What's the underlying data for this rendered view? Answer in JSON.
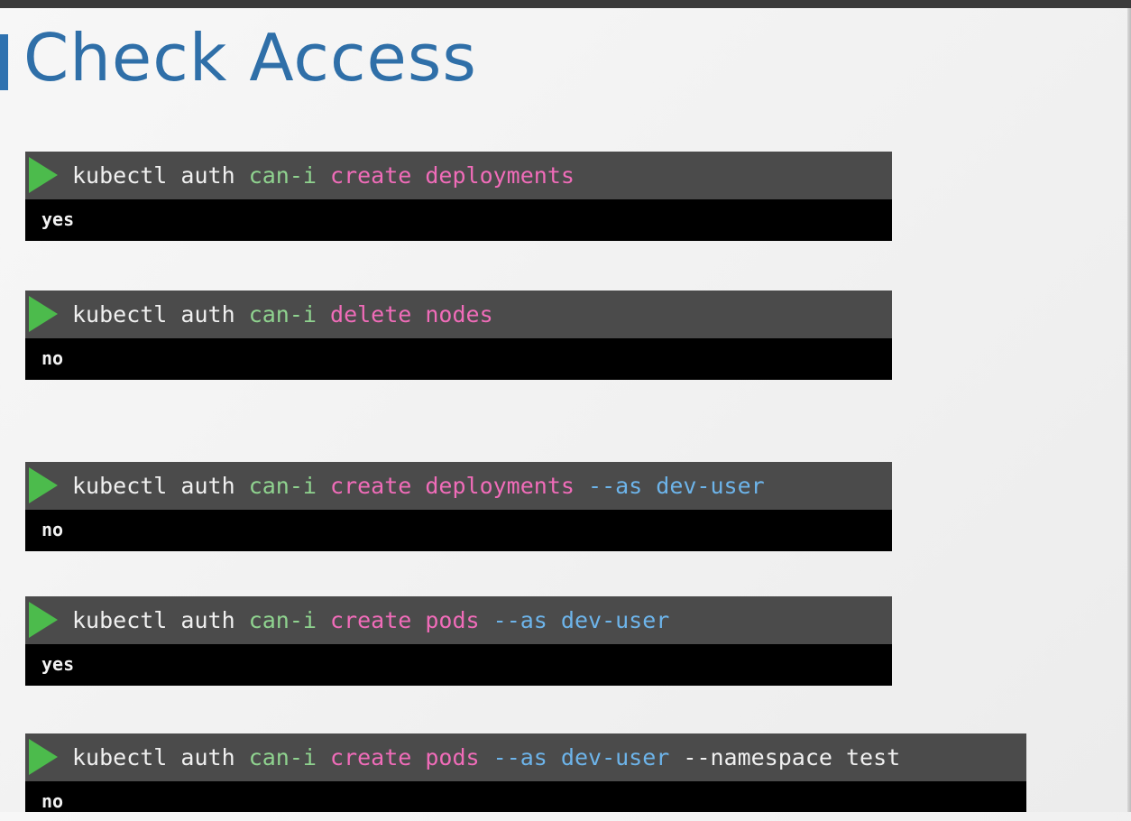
{
  "slide": {
    "title": "Check Access"
  },
  "commands": [
    {
      "tokens": [
        "kubectl auth",
        "can-i",
        "create deployments"
      ],
      "output": "yes"
    },
    {
      "tokens": [
        "kubectl auth",
        "can-i",
        "delete nodes"
      ],
      "output": "no"
    },
    {
      "tokens": [
        "kubectl auth",
        "can-i",
        "create deployments",
        "--as dev-user"
      ],
      "output": "no"
    },
    {
      "tokens": [
        "kubectl auth",
        "can-i",
        "create pods",
        "--as dev-user"
      ],
      "output": "yes"
    },
    {
      "tokens": [
        "kubectl auth",
        "can-i",
        "create pods",
        "--as dev-user",
        "--namespace test"
      ],
      "output": "no"
    }
  ],
  "colors": {
    "title": "#2f6fa8",
    "accent": "#2f72b0",
    "command_bar": "#4b4b4b",
    "output_bar": "#000000",
    "play_icon": "#4cbb4c",
    "keyword_green": "#8fd38f",
    "verb_pink": "#f06cb9",
    "flag_blue": "#6db4ea",
    "plain_text": "#f0f0f0"
  }
}
